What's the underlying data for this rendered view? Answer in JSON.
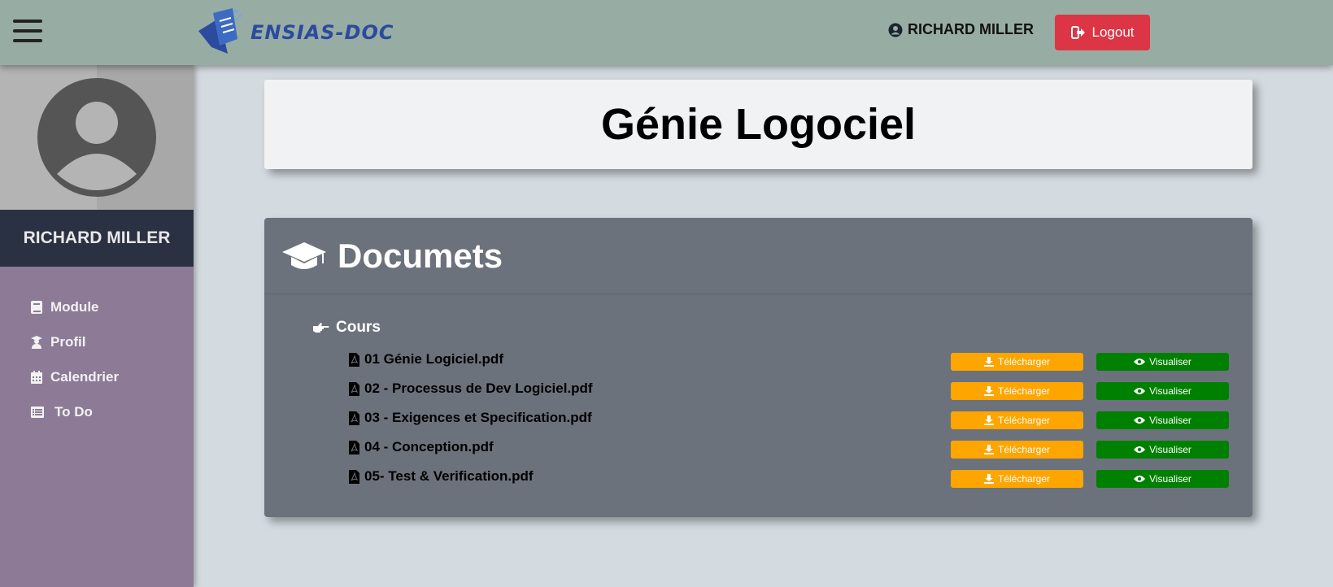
{
  "header": {
    "brand": "ENSIAS-DOC",
    "user_name": "RICHARD MILLER",
    "logout_label": "Logout"
  },
  "sidebar": {
    "user_name": "RICHARD MILLER",
    "items": [
      {
        "label": "Module",
        "icon": "book-icon"
      },
      {
        "label": "Profil",
        "icon": "user-graduate-icon"
      },
      {
        "label": "Calendrier",
        "icon": "calendar-icon"
      },
      {
        "label": "To Do",
        "icon": "list-icon"
      }
    ]
  },
  "page": {
    "title": "Génie Logociel"
  },
  "documents": {
    "heading": "Documets",
    "section": "Cours",
    "download_label": "Télécharger",
    "view_label": "Visualiser",
    "files": [
      {
        "name": "01 Génie Logiciel.pdf"
      },
      {
        "name": "02 - Processus de Dev Logiciel.pdf"
      },
      {
        "name": "03 - Exigences et Specification.pdf"
      },
      {
        "name": "04 - Conception.pdf"
      },
      {
        "name": "05- Test & Verification.pdf"
      }
    ]
  },
  "colors": {
    "topbar": "#97ada3",
    "sidebar": "#8c7a96",
    "logout": "#dc3545",
    "download": "#ffa500",
    "view": "#008000",
    "card": "#6b727c"
  }
}
